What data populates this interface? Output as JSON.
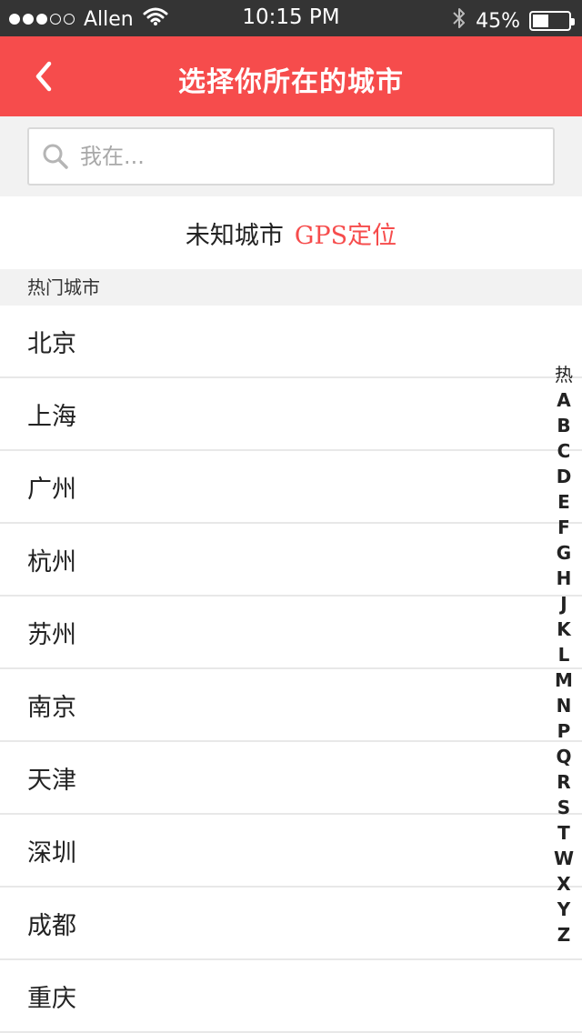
{
  "status_bar": {
    "carrier": "Allen",
    "time": "10:15 PM",
    "battery_percent": "45%",
    "battery_level": 0.45,
    "signal_bars_filled": 3,
    "signal_bars_total": 5,
    "icons": [
      "wifi-icon",
      "bluetooth-icon",
      "battery-icon"
    ]
  },
  "nav": {
    "title": "选择你所在的城市",
    "back_icon": "chevron-left-icon",
    "background_color": "#f64c4c"
  },
  "search": {
    "placeholder": "我在...",
    "value": "",
    "icon": "search-icon"
  },
  "location": {
    "current_city": "未知城市",
    "gps_label": "GPS定位",
    "gps_color": "#f64c4c"
  },
  "hot_cities": {
    "header": "热门城市",
    "items": [
      {
        "label": "北京"
      },
      {
        "label": "上海"
      },
      {
        "label": "广州"
      },
      {
        "label": "杭州"
      },
      {
        "label": "苏州"
      },
      {
        "label": "南京"
      },
      {
        "label": "天津"
      },
      {
        "label": "深圳"
      },
      {
        "label": "成都"
      },
      {
        "label": "重庆"
      }
    ]
  },
  "index_bar": {
    "items": [
      "热",
      "A",
      "B",
      "C",
      "D",
      "E",
      "F",
      "G",
      "H",
      "J",
      "K",
      "L",
      "M",
      "N",
      "P",
      "Q",
      "R",
      "S",
      "T",
      "W",
      "X",
      "Y",
      "Z"
    ]
  }
}
